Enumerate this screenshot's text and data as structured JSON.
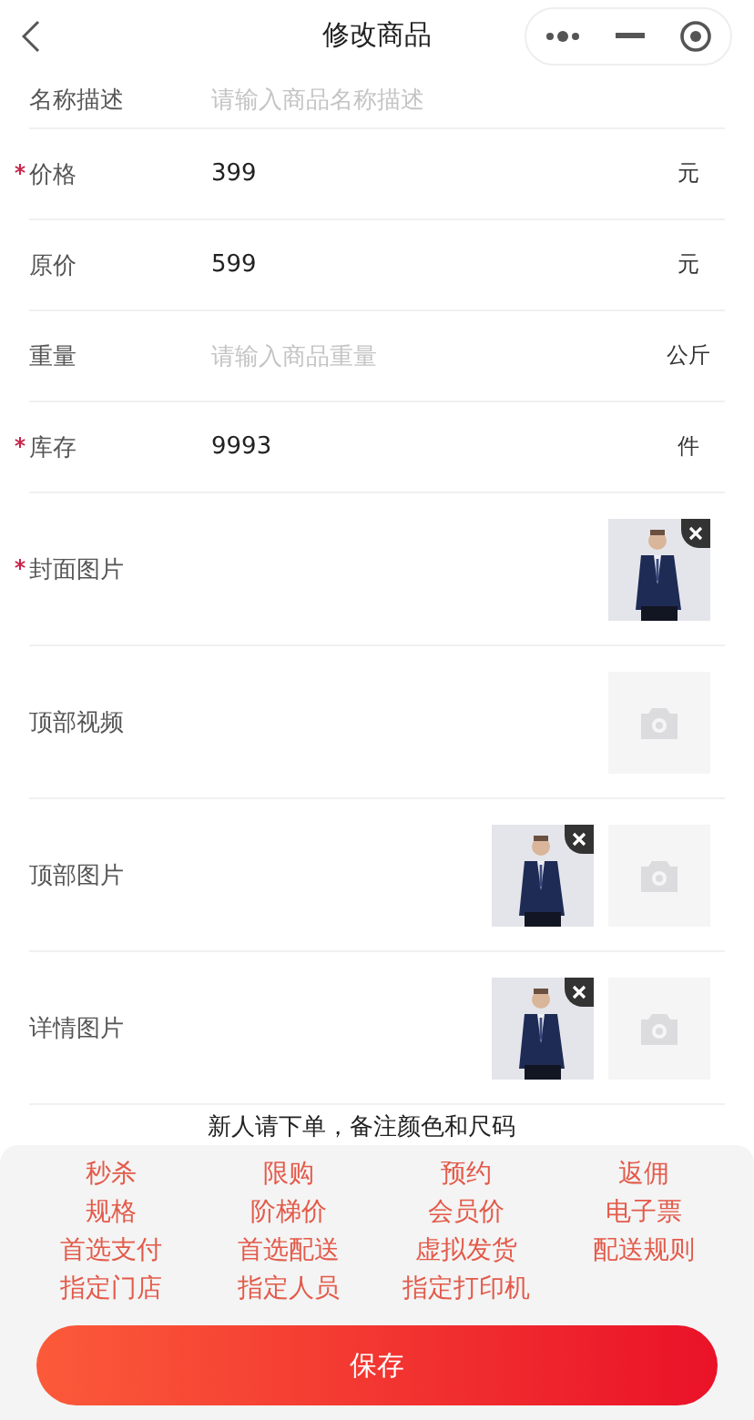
{
  "header": {
    "title": "修改商品"
  },
  "fields": [
    {
      "label": "名称描述",
      "required": false,
      "placeholder": "请输入商品名称描述"
    },
    {
      "label": "价格",
      "required": true,
      "value": "399",
      "unit": "元"
    },
    {
      "label": "原价",
      "required": false,
      "value": "599",
      "unit": "元"
    },
    {
      "label": "重量",
      "required": false,
      "placeholder": "请输入商品重量",
      "unit": "公斤"
    },
    {
      "label": "库存",
      "required": true,
      "value": "9993",
      "unit": "件"
    }
  ],
  "media": [
    {
      "label": "封面图片",
      "required": true,
      "upload_slot": false
    },
    {
      "label": "顶部视频",
      "required": false,
      "upload_slot": true
    },
    {
      "label": "顶部图片",
      "required": false,
      "upload_slot": true
    },
    {
      "label": "详情图片",
      "required": false,
      "upload_slot": true
    }
  ],
  "description": {
    "value": "新人请下单，备注颜色和尺码"
  },
  "options": [
    "秒杀",
    "限购",
    "预约",
    "返佣",
    "规格",
    "阶梯价",
    "会员价",
    "电子票",
    "首选支付",
    "首选配送",
    "虚拟发货",
    "配送规则",
    "指定门店",
    "指定人员",
    "指定打印机"
  ],
  "save_button": "保存"
}
